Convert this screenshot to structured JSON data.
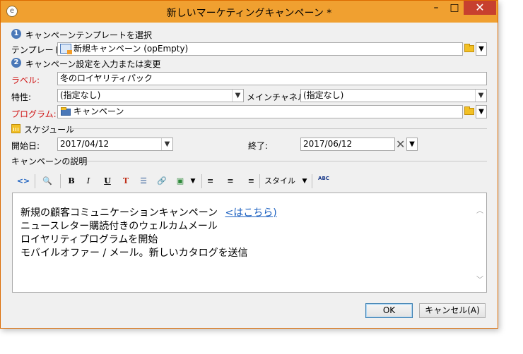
{
  "window": {
    "title": "新しいマーケティングキャンペーン *"
  },
  "titlebar": {
    "minimize": "–",
    "maximize": "□",
    "close": "✕"
  },
  "step1": {
    "number": "1",
    "label": "キャンペーンテンプレートを選択"
  },
  "template": {
    "label": "テンプレート:",
    "value": "新規キャンペーン (opEmpty)"
  },
  "step2": {
    "number": "2",
    "label": "キャンペーン設定を入力または変更"
  },
  "fields": {
    "label_label": "ラベル:",
    "label_value": "冬のロイヤリティパック",
    "nature_label": "特性:",
    "nature_value": "(指定なし)",
    "channel_label": "メインチャネル:",
    "channel_value": "(指定なし)",
    "program_label": "プログラム:",
    "program_value": "キャンペーン"
  },
  "schedule": {
    "title": "スケジュール",
    "start_label": "開始日:",
    "start_value": "2017/04/12",
    "end_label": "終了:",
    "end_value": "2017/06/12"
  },
  "description": {
    "title": "キャンペーンの説明",
    "toolbar": {
      "source": "<>",
      "find": "🔍",
      "bold": "B",
      "italic": "I",
      "underline": "U",
      "textcolor": "T",
      "list": "☰",
      "link": "🔗",
      "image": "▣",
      "align_left": "≡",
      "align_center": "≡",
      "align_right": "≡",
      "style": "スタイル",
      "spellcheck": "ABC"
    },
    "lines": [
      "新規の顧客コミュニケーションキャンペーン",
      "ニュースレター購読付きのウェルカムメール",
      "ロイヤリティプログラムを開始",
      "モバイルオファー / メール。新しいカタログを送信"
    ],
    "link_text": "<はこちら)"
  },
  "buttons": {
    "ok": "OK",
    "cancel": "キャンセル(A)"
  },
  "colors": {
    "titlebar": "#f0a030",
    "required_label": "#d01616",
    "link": "#1a5fc0"
  }
}
